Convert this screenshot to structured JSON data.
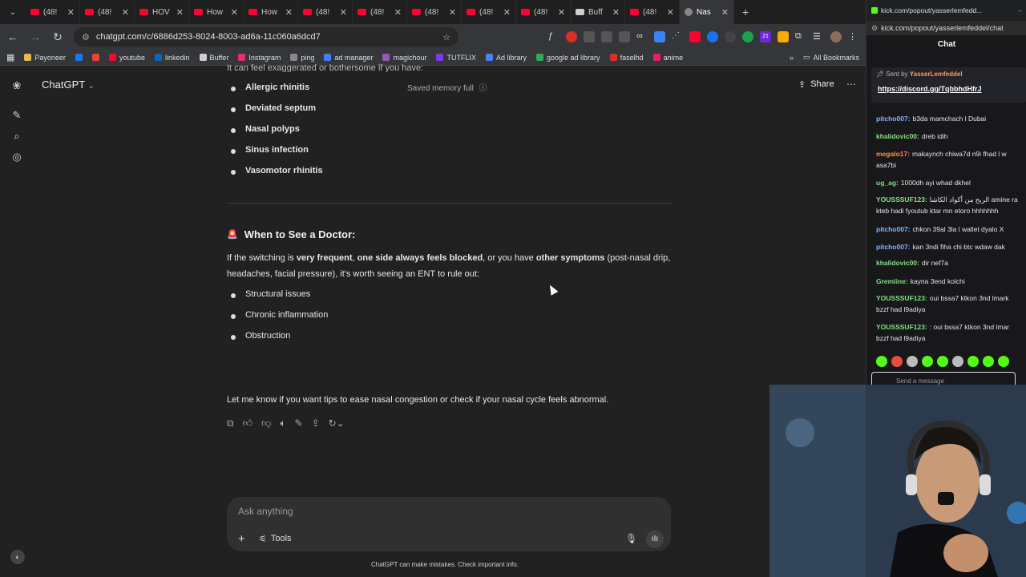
{
  "browser": {
    "tabs": [
      {
        "label": "(48!",
        "icon": "youtube-icon"
      },
      {
        "label": "(48!",
        "icon": "youtube-icon"
      },
      {
        "label": "HOV",
        "icon": "youtube-icon"
      },
      {
        "label": "How",
        "icon": "youtube-icon"
      },
      {
        "label": "How",
        "icon": "youtube-icon"
      },
      {
        "label": "(48!",
        "icon": "youtube-icon"
      },
      {
        "label": "(48!",
        "icon": "youtube-icon"
      },
      {
        "label": "(48!",
        "icon": "youtube-icon"
      },
      {
        "label": "(48!",
        "icon": "youtube-icon"
      },
      {
        "label": "(48!",
        "icon": "youtube-icon"
      },
      {
        "label": "Buff",
        "icon": "buffer-icon"
      },
      {
        "label": "(48!",
        "icon": "youtube-icon"
      },
      {
        "label": "Nas",
        "icon": "chatgpt-icon",
        "active": true
      }
    ],
    "url": "chatgpt.com/c/6886d253-8024-8003-ad6a-11c060a6dcd7",
    "bookmarks": [
      "Payoneer",
      "",
      "",
      "youtube",
      "linkedin",
      "Buffer",
      "Instagram",
      "ping",
      "ad manager",
      "magichour",
      "TUTFLIX",
      "Ad library",
      "google ad library",
      "faselhd",
      "anime"
    ],
    "all_bookmarks": "All Bookmarks",
    "extension_badge": "21"
  },
  "app": {
    "title": "ChatGPT",
    "memory_status": "Saved memory full",
    "share_label": "Share",
    "clipped_line": "It can feel exaggerated or bothersome if you have:",
    "conditions": [
      "Allergic rhinitis",
      "Deviated septum",
      "Nasal polyps",
      "Sinus infection",
      "Vasomotor rhinitis"
    ],
    "heading": "When to See a Doctor:",
    "heading_emoji": "🚨",
    "para": {
      "p1": "If the switching is ",
      "b1": "very frequent",
      "p2": ", ",
      "b2": "one side always feels blocked",
      "p3": ", or you have ",
      "b3": "other symptoms",
      "p4": " (post-nasal drip, headaches, facial pressure), it's worth seeing an ENT to rule out:"
    },
    "reasons": [
      "Structural issues",
      "Chronic inflammation",
      "Obstruction"
    ],
    "closing": "Let me know if you want tips to ease nasal congestion or check if your nasal cycle feels abnormal.",
    "composer_placeholder": "Ask anything",
    "tools_label": "Tools",
    "disclaimer": "ChatGPT can make mistakes. Check important info."
  },
  "chat_panel": {
    "url_top": "kick.com/popout/yasserlemfedd...",
    "url": "kick.com/popout/yasserlemfeddel/chat",
    "title": "Chat",
    "pinned_sent_by": "Sent by",
    "pinned_user": "YasserLemfeddel",
    "pinned_link": "https://discord.gg/TqbbhdHfrJ",
    "messages": [
      {
        "user": "pitcho007:",
        "text": "b3da mamchach l Dubai",
        "color": "#7fb5ff"
      },
      {
        "user": "khalidovic00:",
        "text": "dreb idih",
        "color": "#7fe07f"
      },
      {
        "user": "megalo17:",
        "text": "makaynch chiwa7d n9i fhad l w",
        "color": "#ff8c5a"
      },
      {
        "user": "",
        "text": "asa7bi",
        "color": "#e5e5e5"
      },
      {
        "user": "ug_ag:",
        "text": "1000dh ayi whad dkhel",
        "color": "#7fe07f"
      },
      {
        "user": "YOUSSSUF123:",
        "text": "الربح من أكواد الكاشا amine ra",
        "color": "#7fe07f"
      },
      {
        "user": "",
        "text": "kteb hadi fyoutub ktar mn etoro hhhhhhh",
        "color": "#e5e5e5"
      },
      {
        "user": "pitcho007:",
        "text": "chkon 39al 3la l wallet dyalo X",
        "color": "#7fb5ff"
      },
      {
        "user": "pitcho007:",
        "text": "kan 3ndi fiha chi btc wdaw dak",
        "color": "#7fb5ff"
      },
      {
        "user": "khalidovic00:",
        "text": "dir nef7a",
        "color": "#7fe07f"
      },
      {
        "user": "Gremline:",
        "text": "kayna 3end kolchi",
        "color": "#7fe07f"
      },
      {
        "user": "YOUSSSUF123:",
        "text": "oui bssa7 ktkon 3nd lmark",
        "color": "#7fe07f"
      },
      {
        "user": "",
        "text": "bzzf had l9adiya",
        "color": "#e5e5e5"
      },
      {
        "user": "YOUSSSUF123:",
        "text": ": oui bssa7 ktkon 3nd lmar",
        "color": "#7fe07f"
      },
      {
        "user": "",
        "text": "bzzf had l9adiya",
        "color": "#e5e5e5"
      }
    ],
    "send_placeholder": "Send a message"
  }
}
